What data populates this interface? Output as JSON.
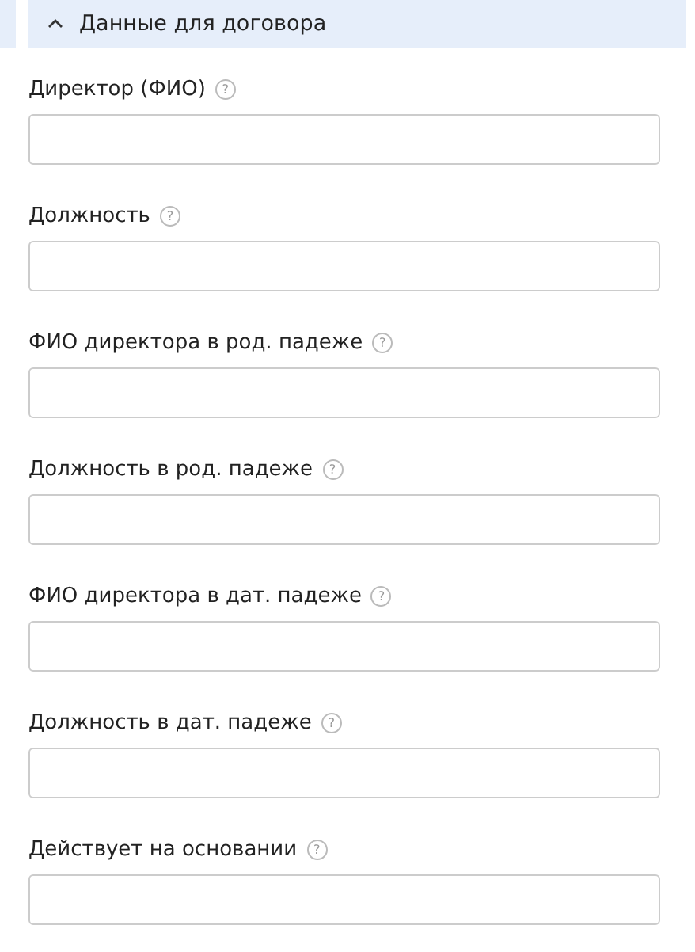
{
  "section": {
    "title": "Данные для договора",
    "expanded": true
  },
  "fields": [
    {
      "label": "Директор (ФИО)",
      "hint_icon": "?"
    },
    {
      "label": "Должность",
      "hint_icon": "?"
    },
    {
      "label": "ФИО директора в род. падеже",
      "hint_icon": "?"
    },
    {
      "label": "Должность в род. падеже",
      "hint_icon": "?"
    },
    {
      "label": "ФИО директора в дат. падеже",
      "hint_icon": "?"
    },
    {
      "label": "Должность в дат. падеже",
      "hint_icon": "?"
    },
    {
      "label": "Действует на основании",
      "hint_icon": "?"
    }
  ]
}
